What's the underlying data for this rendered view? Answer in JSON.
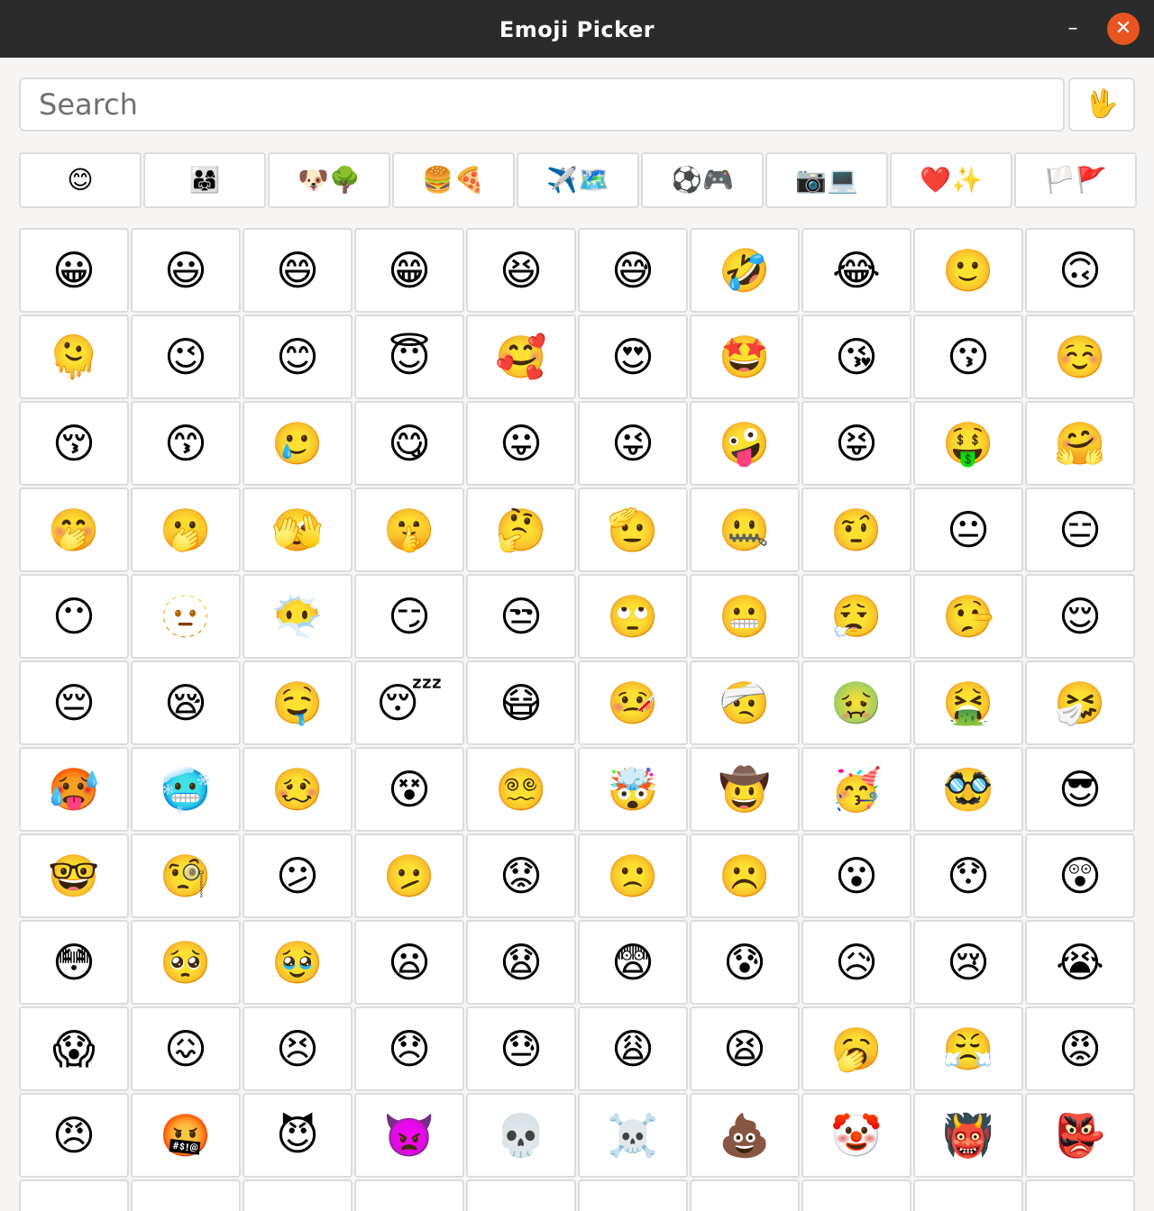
{
  "window": {
    "title": "Emoji Picker",
    "minimize_glyph": "–",
    "close_glyph": "✕",
    "close_color": "#e95420"
  },
  "search": {
    "placeholder": "Search",
    "value": ""
  },
  "skin_tone_button": {
    "glyph": "🖖",
    "icon": "vulcan-salute-icon"
  },
  "categories": [
    {
      "label": "😊",
      "icon": "smileys-category-icon"
    },
    {
      "label": "👨‍👩‍👧",
      "icon": "people-category-icon"
    },
    {
      "label": "🐶🌳",
      "icon": "animals-nature-category-icon"
    },
    {
      "label": "🍔🍕",
      "icon": "food-category-icon"
    },
    {
      "label": "✈️🗺️",
      "icon": "travel-category-icon"
    },
    {
      "label": "⚽🎮",
      "icon": "activities-category-icon"
    },
    {
      "label": "📷💻",
      "icon": "objects-category-icon"
    },
    {
      "label": "❤️✨",
      "icon": "symbols-category-icon"
    },
    {
      "label": "🏳️🚩",
      "icon": "flags-category-icon"
    }
  ],
  "emoji_rows": [
    [
      "😀",
      "😃",
      "😄",
      "😁",
      "😆",
      "😅",
      "🤣",
      "😂",
      "🙂",
      "🙃"
    ],
    [
      "🫠",
      "😉",
      "😊",
      "😇",
      "🥰",
      "😍",
      "🤩",
      "😘",
      "😗",
      "☺️"
    ],
    [
      "😚",
      "😙",
      "🥲",
      "😋",
      "😛",
      "😜",
      "🤪",
      "😝",
      "🤑",
      "🤗"
    ],
    [
      "🤭",
      "🫢",
      "🫣",
      "🤫",
      "🤔",
      "🫡",
      "🤐",
      "🤨",
      "😐",
      "😑"
    ],
    [
      "😶",
      "🫥",
      "😶‍🌫️",
      "😏",
      "😒",
      "🙄",
      "😬",
      "😮‍💨",
      "🤥",
      "😌"
    ],
    [
      "😔",
      "😪",
      "🤤",
      "😴",
      "😷",
      "🤒",
      "🤕",
      "🤢",
      "🤮",
      "🤧"
    ],
    [
      "🥵",
      "🥶",
      "🥴",
      "😵",
      "😵‍💫",
      "🤯",
      "🤠",
      "🥳",
      "🥸",
      "😎"
    ],
    [
      "🤓",
      "🧐",
      "😕",
      "🫤",
      "😟",
      "🙁",
      "☹️",
      "😮",
      "😯",
      "😲"
    ],
    [
      "😳",
      "🥺",
      "🥹",
      "😦",
      "😧",
      "😨",
      "😰",
      "😥",
      "😢",
      "😭"
    ],
    [
      "😱",
      "😖",
      "😣",
      "😞",
      "😓",
      "😩",
      "😫",
      "🥱",
      "😤",
      "😡"
    ],
    [
      "😠",
      "🤬",
      "😈",
      "👿",
      "💀",
      "☠️",
      "💩",
      "🤡",
      "👹",
      "👺"
    ],
    [
      "",
      "",
      "",
      "",
      "",
      "",
      "",
      "",
      "",
      ""
    ]
  ]
}
